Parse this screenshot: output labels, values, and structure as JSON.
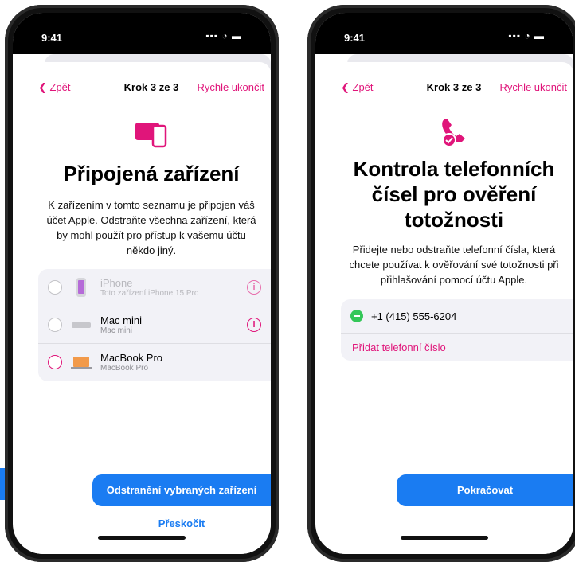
{
  "left": {
    "status": {
      "time": "9:41",
      "indicators": "▪▪▪ ◔ ▬"
    },
    "nav": {
      "back": "Zpět",
      "step": "Krok 3 ze 3",
      "quit": "Rychle ukončit"
    },
    "icon": "devices-icon",
    "title": "Připojená zařízení",
    "subtitle": "K zařízením v tomto seznamu je připojen váš účet Apple. Odstraňte všechna zařízení, která by mohl použít pro přístup k vašemu účtu někdo jiný.",
    "devices": [
      {
        "name": "iPhone",
        "detail": "Toto zařízení iPhone 15 Pro",
        "disabled": true
      },
      {
        "name": "Mac mini",
        "detail": "Mac mini",
        "disabled": false
      },
      {
        "name": "MacBook Pro",
        "detail": "MacBook Pro",
        "disabled": false
      }
    ],
    "primary_button": "Odstranění vybraných zařízení",
    "skip": "Přeskočit"
  },
  "right": {
    "status": {
      "time": "9:41",
      "indicators": "▪▪▪ ◔ ▬"
    },
    "nav": {
      "back": "Zpět",
      "step": "Krok 3 ze 3",
      "quit": "Rychle ukončit"
    },
    "icon": "phone-checkmark-icon",
    "title": "Kontrola telefonních čísel pro ověření totožnosti",
    "subtitle": "Přidejte nebo odstraňte telefonní čísla, která chcete používat k ověřování své totožnosti při přihlašování pomocí účtu Apple.",
    "phone_number": "+1 (415) 555-6204",
    "add_phone": "Přidat telefonní číslo",
    "primary_button": "Pokračovat"
  },
  "colors": {
    "accent": "#e0157a",
    "button": "#1a7cf2",
    "remove": "#34c759"
  }
}
